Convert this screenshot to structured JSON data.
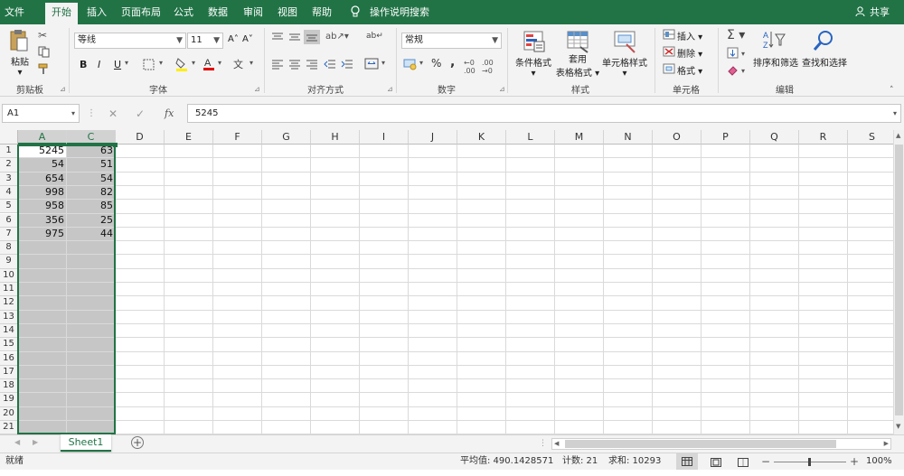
{
  "tabs": [
    "文件",
    "开始",
    "插入",
    "页面布局",
    "公式",
    "数据",
    "审阅",
    "视图",
    "帮助",
    "操作说明搜索"
  ],
  "share_label": "共享",
  "clipboard": {
    "paste": "粘贴",
    "group": "剪贴板"
  },
  "font": {
    "name": "等线",
    "size": "11",
    "group": "字体",
    "bold": "B",
    "italic": "I",
    "underline": "U"
  },
  "alignment": {
    "group": "对齐方式"
  },
  "number": {
    "format": "常规",
    "group": "数字",
    "percent": "%",
    "comma": ","
  },
  "styles": {
    "conditional": "条件格式",
    "table1": "套用",
    "table2": "表格格式",
    "cell": "单元格样式",
    "group": "样式"
  },
  "cells": {
    "insert": "插入",
    "delete": "删除",
    "format": "格式",
    "group": "单元格"
  },
  "editing": {
    "sort": "排序和筛选",
    "find": "查找和选择",
    "group": "编辑"
  },
  "formula_bar": {
    "name_box": "A1",
    "fx": "fx",
    "value": "5245"
  },
  "columns": [
    "A",
    "C",
    "D",
    "E",
    "F",
    "G",
    "H",
    "I",
    "J",
    "K",
    "L",
    "M",
    "N",
    "O",
    "P",
    "Q",
    "R",
    "S"
  ],
  "rows": [
    "1",
    "2",
    "3",
    "4",
    "5",
    "6",
    "7",
    "8",
    "9",
    "10",
    "11",
    "12",
    "13",
    "14",
    "15",
    "16",
    "17",
    "18",
    "19",
    "20",
    "21"
  ],
  "cells_data": {
    "A": [
      "5245",
      "54",
      "654",
      "998",
      "958",
      "356",
      "975"
    ],
    "C": [
      "63",
      "51",
      "54",
      "82",
      "85",
      "25",
      "44"
    ]
  },
  "sheet_name": "Sheet1",
  "status": {
    "mode": "就绪",
    "average": "平均值: 490.1428571",
    "count": "计数: 21",
    "sum": "求和: 10293",
    "zoom": "100%"
  },
  "colors": {
    "accent": "#217346",
    "selection": "#c6c6c6"
  }
}
